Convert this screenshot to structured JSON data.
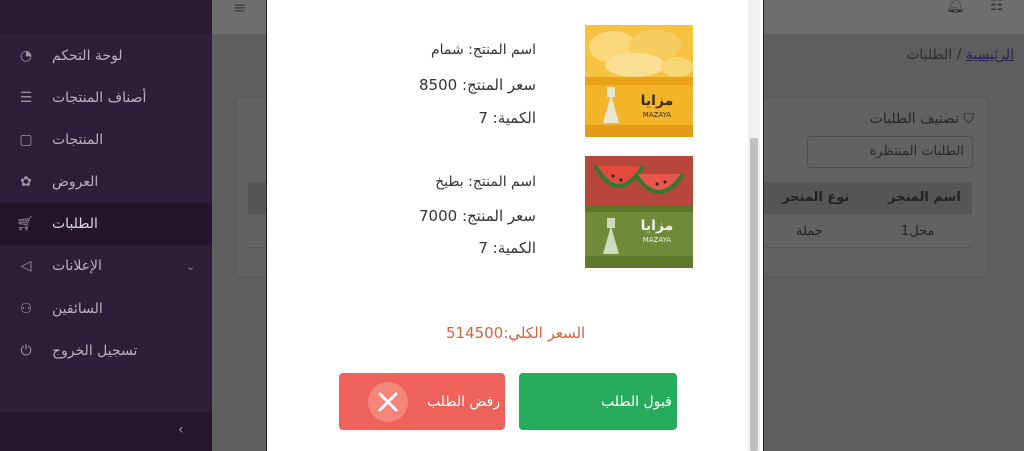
{
  "sidebar": {
    "items": [
      {
        "label": "لوحة التحكم",
        "icon": "dashboard-icon"
      },
      {
        "label": "أصناف المنتجات",
        "icon": "layers-icon"
      },
      {
        "label": "المنتجات",
        "icon": "box-icon"
      },
      {
        "label": "العروض",
        "icon": "offers-icon"
      },
      {
        "label": "الطلبات",
        "icon": "cart-icon"
      },
      {
        "label": "الإعلانات",
        "icon": "megaphone-icon"
      },
      {
        "label": "السائقين",
        "icon": "users-icon"
      },
      {
        "label": "تسجيل الخروج",
        "icon": "power-icon"
      }
    ],
    "active_index": 4
  },
  "breadcrumb": {
    "home": "الرئيسية",
    "separator": "/",
    "current": "الطلبات"
  },
  "filter": {
    "title": "تصنيف الطلبات",
    "selected": "الطلبات المنتظرة"
  },
  "table": {
    "headers": [
      "اسم المتجر",
      "نوع المتجر"
    ],
    "rows": [
      [
        "محل1",
        "جملة"
      ]
    ]
  },
  "modal": {
    "products": [
      {
        "name_line": "اسم المنتج: شمام",
        "price_line": "سعر المنتج: 8500",
        "qty_line": "الكمية: 7",
        "image": "melon-tobacco-box",
        "brand": "مزايا",
        "brand_latin": "MAZAYA"
      },
      {
        "name_line": "اسم المنتج: بطيخ",
        "price_line": "سعر المنتج: 7000",
        "qty_line": "الكمية: 7",
        "image": "watermelon-tobacco-box",
        "brand": "مزايا",
        "brand_latin": "MAZAYA"
      }
    ],
    "total": "السعر الكلي:514500",
    "accept_label": "قبول الطلب",
    "reject_label": "رفض الطلب"
  },
  "colors": {
    "accept": "#27ab5c",
    "reject": "#ee6259",
    "total_text": "#d0643f",
    "sidebar_bg": "#2d1f3a"
  }
}
